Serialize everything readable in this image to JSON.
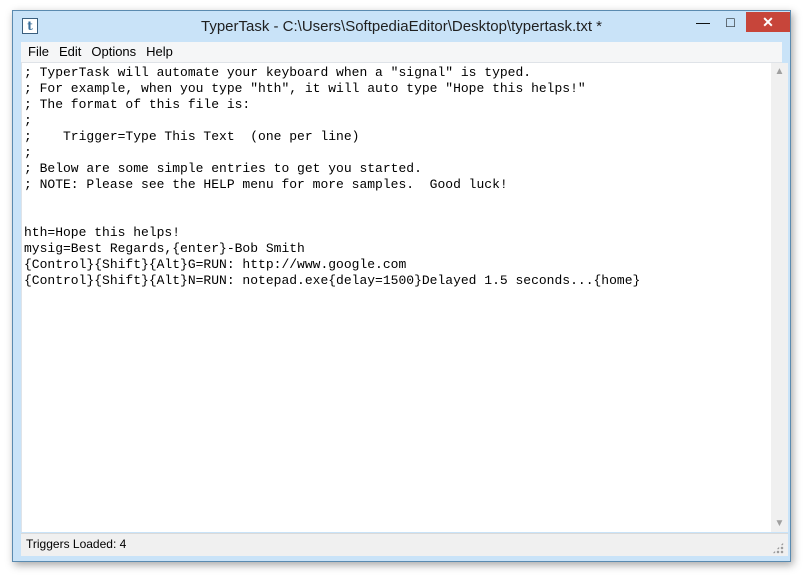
{
  "window": {
    "title": "TyperTask - C:\\Users\\SoftpediaEditor\\Desktop\\typertask.txt *",
    "icon": "notepad-icon",
    "controls": {
      "minimize": "—",
      "maximize": "□",
      "close": "✕"
    }
  },
  "menu": {
    "file": "File",
    "edit": "Edit",
    "options": "Options",
    "help": "Help"
  },
  "editor": {
    "content": "; TyperTask will automate your keyboard when a \"signal\" is typed.\n; For example, when you type \"hth\", it will auto type \"Hope this helps!\"\n; The format of this file is:\n;\n;    Trigger=Type This Text  (one per line)\n;\n; Below are some simple entries to get you started.\n; NOTE: Please see the HELP menu for more samples.  Good luck!\n\n\nhth=Hope this helps!\nmysig=Best Regards,{enter}-Bob Smith\n{Control}{Shift}{Alt}G=RUN: http://www.google.com\n{Control}{Shift}{Alt}N=RUN: notepad.exe{delay=1500}Delayed 1.5 seconds...{home}"
  },
  "scrollbar": {
    "up": "▲",
    "down": "▼"
  },
  "status": {
    "text": "Triggers Loaded: 4"
  }
}
